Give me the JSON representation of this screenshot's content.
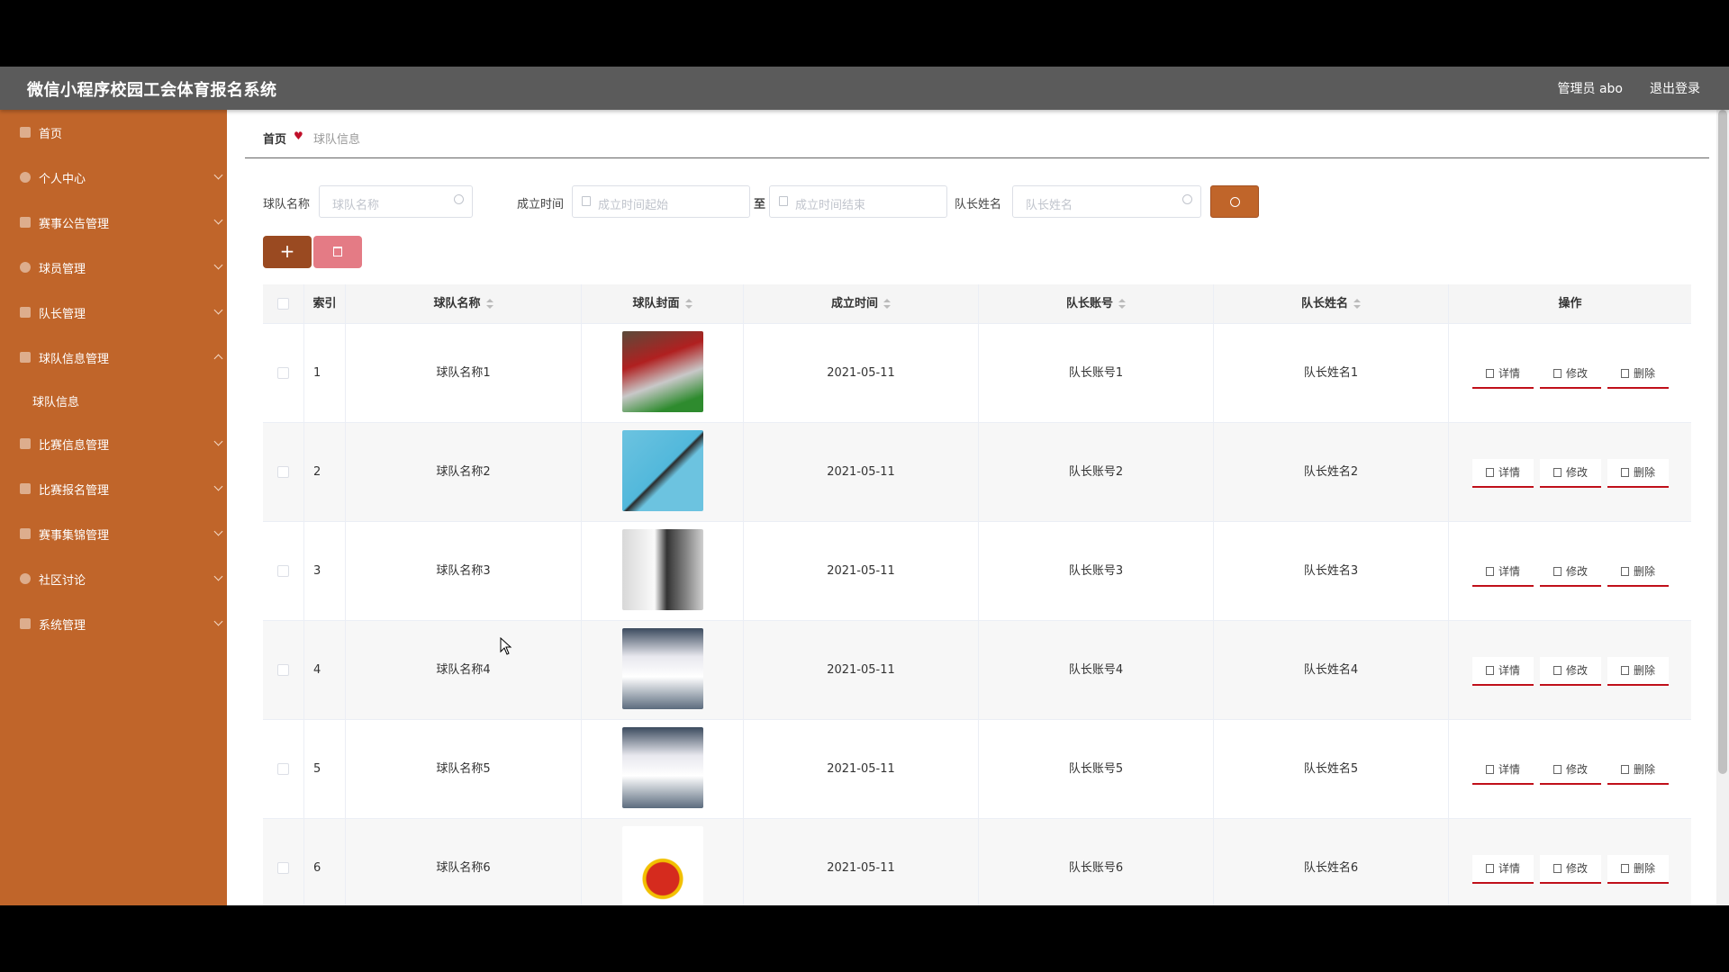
{
  "app": {
    "title": "微信小程序校园工会体育报名系统",
    "user": "管理员 abo",
    "logout": "退出登录"
  },
  "sidebar": {
    "items": [
      {
        "label": "首页",
        "icon": "home-icon",
        "expandable": false
      },
      {
        "label": "个人中心",
        "icon": "user-icon",
        "expandable": true
      },
      {
        "label": "赛事公告管理",
        "icon": "notice-icon",
        "expandable": true
      },
      {
        "label": "球员管理",
        "icon": "player-icon",
        "expandable": true
      },
      {
        "label": "队长管理",
        "icon": "send-icon",
        "expandable": true
      },
      {
        "label": "球队信息管理",
        "icon": "flag-icon",
        "expandable": true,
        "expanded": true,
        "children": [
          "球队信息"
        ]
      },
      {
        "label": "比赛信息管理",
        "icon": "frame-icon",
        "expandable": true
      },
      {
        "label": "比赛报名管理",
        "icon": "register-icon",
        "expandable": true
      },
      {
        "label": "赛事集锦管理",
        "icon": "highlight-icon",
        "expandable": true
      },
      {
        "label": "社区讨论",
        "icon": "chat-icon",
        "expandable": true
      },
      {
        "label": "系统管理",
        "icon": "settings-icon",
        "expandable": true
      }
    ]
  },
  "breadcrumb": {
    "home": "首页",
    "current": "球队信息"
  },
  "filter": {
    "team_name_label": "球队名称",
    "team_name_placeholder": "球队名称",
    "found_time_label": "成立时间",
    "start_placeholder": "成立时间起始",
    "to": "至",
    "end_placeholder": "成立时间结束",
    "captain_label": "队长姓名",
    "captain_placeholder": "队长姓名"
  },
  "toolbar": {
    "add_label": "+"
  },
  "table": {
    "headers": [
      "索引",
      "球队名称",
      "球队封面",
      "成立时间",
      "队长账号",
      "队长姓名",
      "操作"
    ],
    "rows": [
      {
        "index": "1",
        "name": "球队名称1",
        "date": "2021-05-11",
        "account": "队长账号1",
        "captain": "队长姓名1"
      },
      {
        "index": "2",
        "name": "球队名称2",
        "date": "2021-05-11",
        "account": "队长账号2",
        "captain": "队长姓名2"
      },
      {
        "index": "3",
        "name": "球队名称3",
        "date": "2021-05-11",
        "account": "队长账号3",
        "captain": "队长姓名3"
      },
      {
        "index": "4",
        "name": "球队名称4",
        "date": "2021-05-11",
        "account": "队长账号4",
        "captain": "队长姓名4"
      },
      {
        "index": "5",
        "name": "球队名称5",
        "date": "2021-05-11",
        "account": "队长账号5",
        "captain": "队长姓名5"
      },
      {
        "index": "6",
        "name": "球队名称6",
        "date": "2021-05-11",
        "account": "队长账号6",
        "captain": "队长姓名6"
      }
    ],
    "actions": {
      "detail": "详情",
      "edit": "修改",
      "delete": "删除"
    }
  },
  "colors": {
    "sidebar": "#c0652a",
    "topbar": "#5b5b5b",
    "accent": "#c0101a"
  }
}
